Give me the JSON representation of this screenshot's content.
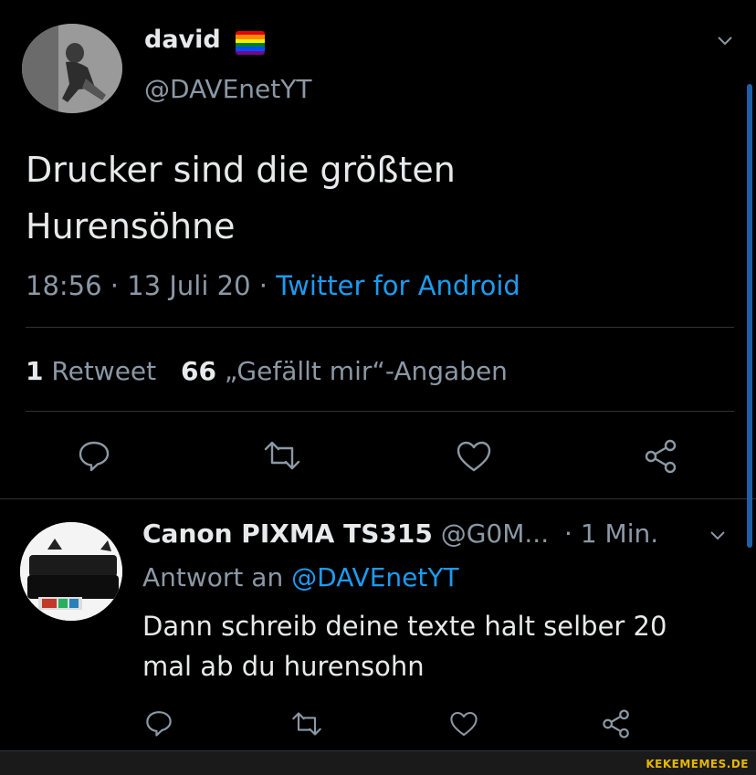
{
  "tweet": {
    "display_name": "david",
    "display_name_emoji": "🏳️‍🌈",
    "handle": "@DAVEnetYT",
    "text_line1": "Drucker sind die größten",
    "text_line2": "Hurensöhne",
    "time": "18:56",
    "sep1": "·",
    "date": "13 Juli 20",
    "sep2": "·",
    "source": "Twitter for Android",
    "retweet_count": "1",
    "retweet_label": "Retweet",
    "like_count": "66",
    "like_label": "„Gefällt mir“-Angaben",
    "actions": [
      "reply-icon",
      "retweet-icon",
      "like-icon",
      "share-icon"
    ]
  },
  "reply": {
    "display_name": "Canon PIXMA TS315",
    "handle": "@G0M...",
    "sep": "·",
    "time": "1 Min.",
    "reply_to_prefix": "Antwort an",
    "reply_to_handle": "@DAVEnetYT",
    "text_line1": "Dann schreib deine texte halt selber 20",
    "text_line2": "mal ab du hurensohn",
    "actions": [
      "reply-icon",
      "retweet-icon",
      "like-icon",
      "share-icon"
    ]
  },
  "watermark": "KEKEMEMES.DE",
  "colors": {
    "background": "#000000",
    "text": "#e7e9ea",
    "muted": "#8b98a5",
    "link": "#1d9bf0",
    "scrollbar": "#1e5fa8"
  }
}
